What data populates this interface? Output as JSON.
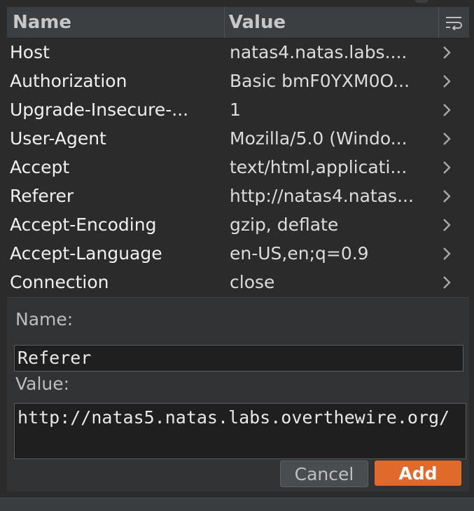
{
  "table": {
    "headers": {
      "name": "Name",
      "value": "Value"
    },
    "wrap_icon": "wrap-lines-icon",
    "rows": [
      {
        "name": "Host",
        "value": "natas4.natas.labs...."
      },
      {
        "name": "Authorization",
        "value": "Basic bmF0YXM0O..."
      },
      {
        "name": "Upgrade-Insecure-...",
        "value": "1"
      },
      {
        "name": "User-Agent",
        "value": "Mozilla/5.0 (Windo..."
      },
      {
        "name": "Accept",
        "value": "text/html,applicati..."
      },
      {
        "name": "Referer",
        "value": "http://natas4.natas..."
      },
      {
        "name": "Accept-Encoding",
        "value": "gzip, deflate"
      },
      {
        "name": "Accept-Language",
        "value": "en-US,en;q=0.9"
      },
      {
        "name": "Connection",
        "value": "close"
      }
    ]
  },
  "editor": {
    "name_label": "Name:",
    "name_value": "Referer",
    "value_label": "Value:",
    "value_value": "http://natas5.natas.labs.overthewire.org/",
    "cancel_label": "Cancel",
    "add_label": "Add"
  },
  "colors": {
    "accent": "#e06a2c",
    "header_bg": "#3c3f41",
    "panel_bg": "#2b2b2b"
  }
}
